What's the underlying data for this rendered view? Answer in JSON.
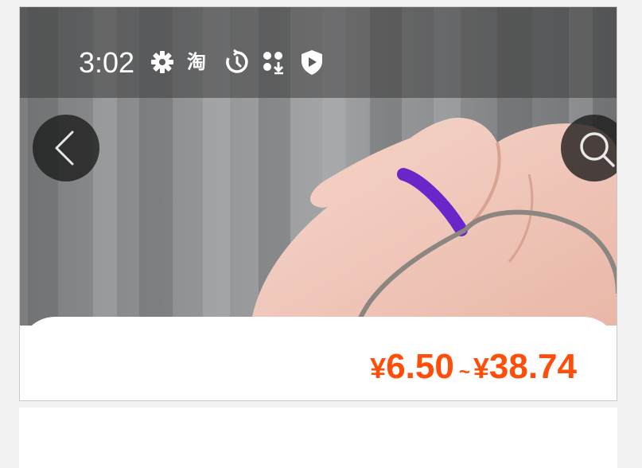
{
  "status_bar": {
    "time": "3:02",
    "taobao_glyph": "淘",
    "icons": [
      "gear-icon",
      "taobao-icon",
      "timer-icon",
      "download-icon",
      "play-shield-icon"
    ]
  },
  "nav": {
    "back_icon": "chevron-left-icon",
    "search_icon": "search-icon"
  },
  "product": {
    "price": {
      "currency": "¥",
      "min": "6.50",
      "separator": "~",
      "max": "38.74",
      "color": "#ff4d0a"
    }
  }
}
